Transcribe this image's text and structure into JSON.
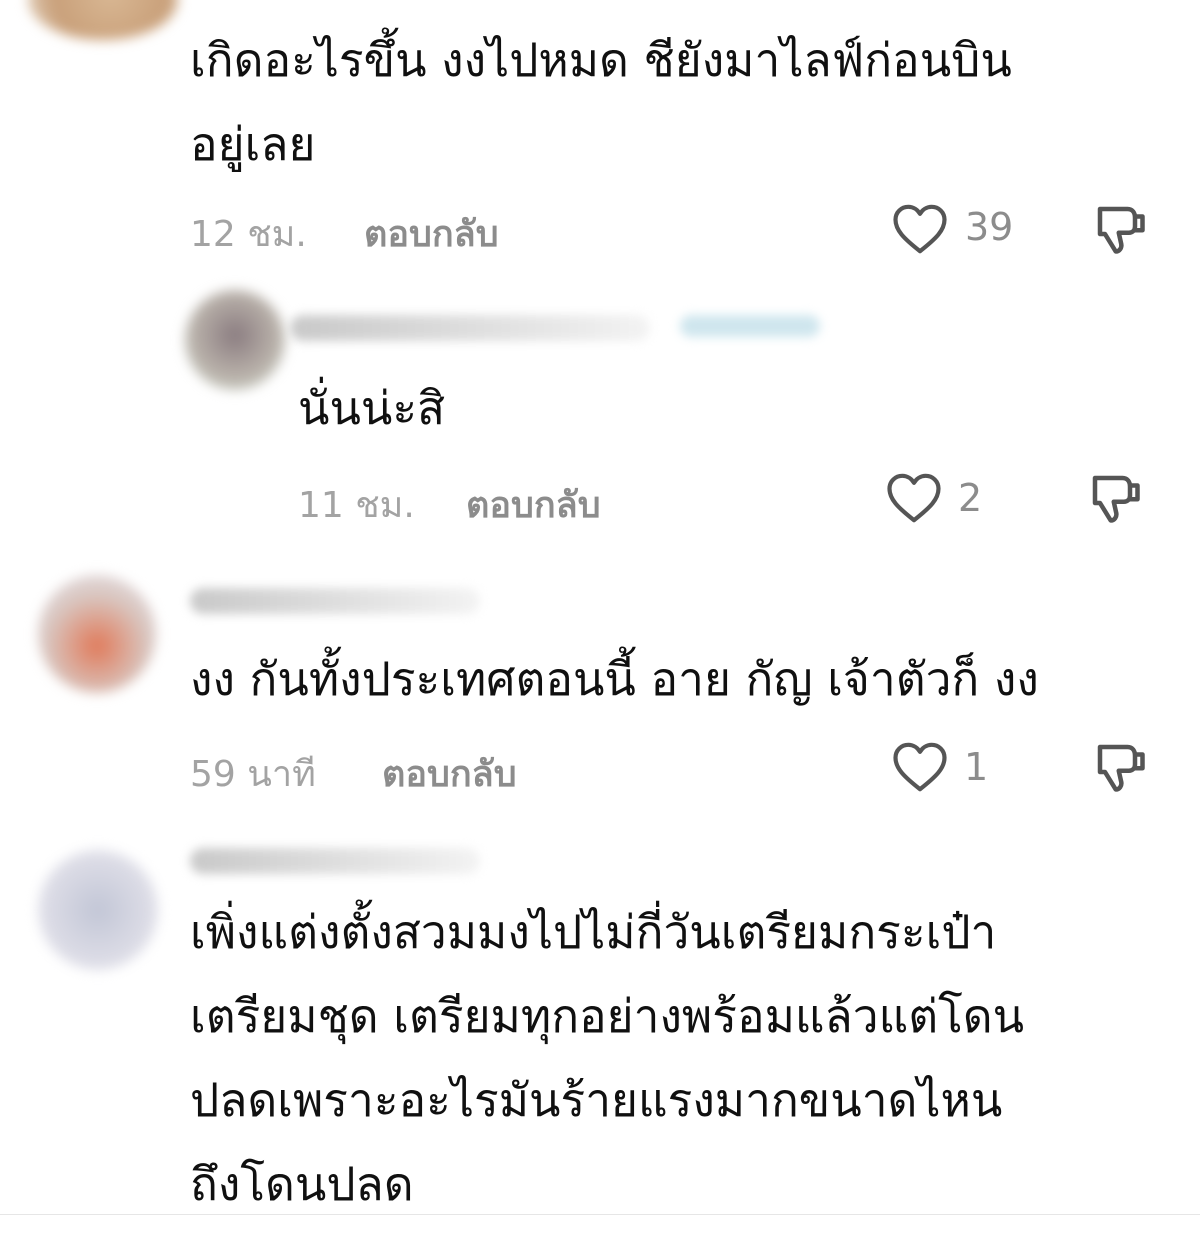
{
  "comments": [
    {
      "text": "เกิดอะไรขึ้น งงไปหมด ชียังมาไลฟ์ก่อนบิน\nอยู่เลย",
      "time": "12 ชม.",
      "reply_label": "ตอบกลับ",
      "likes": "39"
    },
    {
      "text": "นั่นน่ะสิ",
      "time": "11 ชม.",
      "reply_label": "ตอบกลับ",
      "likes": "2"
    },
    {
      "text": "งง กันทั้งประเทศตอนนี้ อาย กัญ เจ้าตัวก็ งง",
      "time": "59 นาที",
      "reply_label": "ตอบกลับ",
      "likes": "1"
    },
    {
      "text": "เพิ่งแต่งตั้งสวมมงไปไม่กี่วันเตรียมกระเป๋า\nเตรียมชุด เตรียมทุกอย่างพร้อมแล้วแต่โดน\nปลดเพราะอะไรมันร้ายแรงมากขนาดไหน\nถึงโดนปลด"
    }
  ],
  "icons": {
    "like": "heart-outline-icon",
    "dislike": "thumbs-down-icon"
  },
  "colors": {
    "text": "#101010",
    "meta": "#a3a3a3",
    "reply": "#8c8c8c",
    "icon": "#555555"
  }
}
